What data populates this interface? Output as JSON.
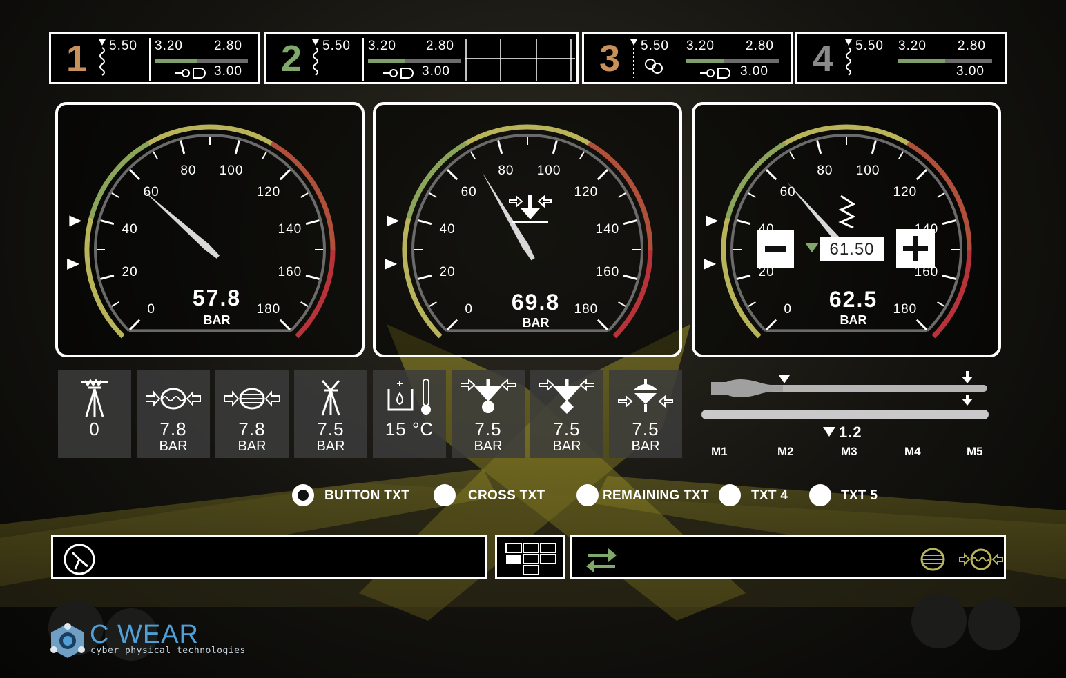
{
  "status_boxes": [
    {
      "number": "1",
      "color": "#c8905a",
      "top_left": "5.50",
      "top_mid": "3.20",
      "top_right": "2.80",
      "bottom": "3.00",
      "bar_fill": 0.45
    },
    {
      "number": "2",
      "color": "#7fa86a",
      "top_left": "5.50",
      "top_mid": "3.20",
      "top_right": "2.80",
      "bottom": "3.00",
      "bar_fill": 0.4
    },
    {
      "number": "3",
      "color": "#c8905a",
      "top_left": "5.50",
      "top_mid": "3.20",
      "top_right": "2.80",
      "bottom": "3.00",
      "bar_fill": 0.4
    },
    {
      "number": "4",
      "color": "#8a8a8a",
      "top_left": "5.50",
      "top_mid": "3.20",
      "top_right": "2.80",
      "bottom": "3.00",
      "bar_fill": 0.5
    }
  ],
  "gauges": [
    {
      "value": "57.8",
      "unit": "BAR",
      "needle": 57.8,
      "ticks": [
        "0",
        "20",
        "40",
        "60",
        "80",
        "100",
        "120",
        "140",
        "160",
        "180"
      ]
    },
    {
      "value": "69.8",
      "unit": "BAR",
      "needle": 69.8,
      "ticks": [
        "0",
        "20",
        "40",
        "60",
        "80",
        "100",
        "120",
        "140",
        "160",
        "180"
      ]
    },
    {
      "value": "62.5",
      "unit": "BAR",
      "needle": 62.5,
      "setpoint": "61.50",
      "ticks": [
        "0",
        "20",
        "40",
        "60",
        "80",
        "100",
        "120",
        "140",
        "160",
        "180"
      ]
    }
  ],
  "tiles": [
    {
      "icon": "drill-bit-icon",
      "value": "0",
      "unit": ""
    },
    {
      "icon": "rotation-pressure-icon",
      "value": "7.8",
      "unit": "BAR"
    },
    {
      "icon": "feed-pressure-icon",
      "value": "7.8",
      "unit": "BAR"
    },
    {
      "icon": "drill-bit-icon",
      "value": "7.5",
      "unit": "BAR"
    },
    {
      "icon": "water-temperature-icon",
      "value": "15",
      "unit": "°C"
    },
    {
      "icon": "percussion-pressure-icon",
      "value": "7.5",
      "unit": "BAR"
    },
    {
      "icon": "damper-pressure-icon",
      "value": "7.5",
      "unit": "BAR"
    },
    {
      "icon": "flushing-pressure-icon",
      "value": "7.5",
      "unit": "BAR"
    }
  ],
  "slider": {
    "value": "1.2",
    "labels": [
      "M1",
      "M2",
      "M3",
      "M4",
      "M5"
    ]
  },
  "radios": [
    {
      "label": "BUTTON TXT",
      "selected": true
    },
    {
      "label": "CROSS TXT",
      "selected": false
    },
    {
      "label": "REMAINING TXT",
      "selected": false
    },
    {
      "label": "TXT 4",
      "selected": false
    },
    {
      "label": "TXT 5",
      "selected": false
    }
  ],
  "brand": {
    "name": "C WEAR",
    "tagline": "cyber physical technologies"
  },
  "colors": {
    "green": "#7fa86a",
    "orange": "#c8905a",
    "red": "#b8323a",
    "olive": "#b9b45a"
  }
}
